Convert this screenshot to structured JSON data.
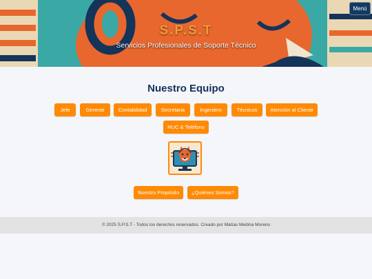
{
  "header": {
    "title": "S.P.S.T",
    "subtitle": "Servicios Profesionales de Soporte Técnico",
    "menu_label": "Menú"
  },
  "team": {
    "heading": "Nuestro Equipo",
    "buttons": [
      "Jefe",
      "Gerente",
      "Contabilidad",
      "Secretaria",
      "Ingeniero",
      "Técnicos",
      "Atención al Cliente",
      "RUC & Teléfono"
    ]
  },
  "links": [
    "Nuestro Propósito",
    "¿Quiénes Somos?"
  ],
  "footer": {
    "text": "© 2025 S.P.S.T - Todos los derechos reservados. Creado por Matías Medina Moreno"
  },
  "colors": {
    "accent": "#ff8a05",
    "heading": "#15305a",
    "menu_bg": "#123a63",
    "footer_bg": "#e3e3e3"
  }
}
